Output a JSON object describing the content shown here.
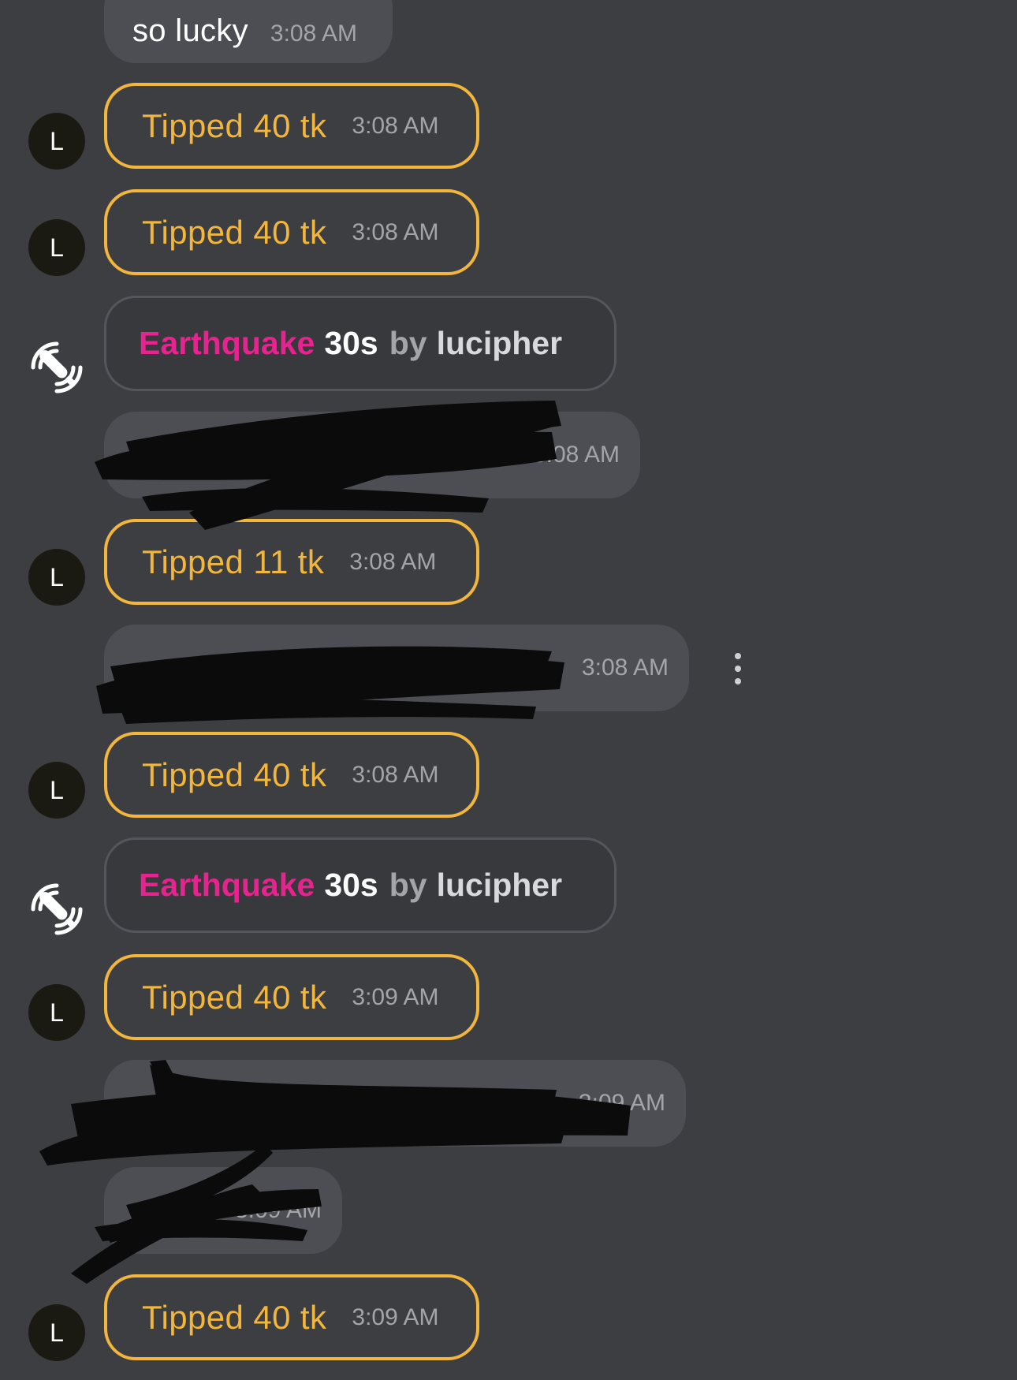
{
  "messages": {
    "top": {
      "text": "so lucky",
      "time": "3:08 AM"
    },
    "redacted1": {
      "text": "",
      "time": "3:08 AM"
    },
    "redacted2": {
      "text": "",
      "time": "3:08 AM"
    },
    "redacted3": {
      "text": "",
      "time": "3:09 AM"
    },
    "redacted4": {
      "text": "",
      "time": "3:09 AM"
    }
  },
  "tips": [
    {
      "avatar": "L",
      "text": "Tipped 40 tk",
      "time": "3:08 AM"
    },
    {
      "avatar": "L",
      "text": "Tipped 40 tk",
      "time": "3:08 AM"
    },
    {
      "avatar": "L",
      "text": "Tipped 11 tk",
      "time": "3:08 AM"
    },
    {
      "avatar": "L",
      "text": "Tipped 40 tk",
      "time": "3:08 AM"
    },
    {
      "avatar": "L",
      "text": "Tipped 40 tk",
      "time": "3:09 AM"
    },
    {
      "avatar": "L",
      "text": "Tipped 40 tk",
      "time": "3:09 AM"
    }
  ],
  "events": [
    {
      "name": "Earthquake",
      "duration": "30s",
      "by": "by",
      "user": "lucipher",
      "icon": "vibrator-icon"
    },
    {
      "name": "Earthquake",
      "duration": "30s",
      "by": "by",
      "user": "lucipher",
      "icon": "vibrator-icon"
    }
  ],
  "colors": {
    "background": "#3d3e42",
    "tip_accent": "#f1b63b",
    "event_name": "#e8238f",
    "message_bubble": "#4d4e53",
    "timestamp": "#a4a5a8"
  },
  "icons": {
    "message_options": "more-vertical-icon",
    "event": "vibrator-icon"
  }
}
